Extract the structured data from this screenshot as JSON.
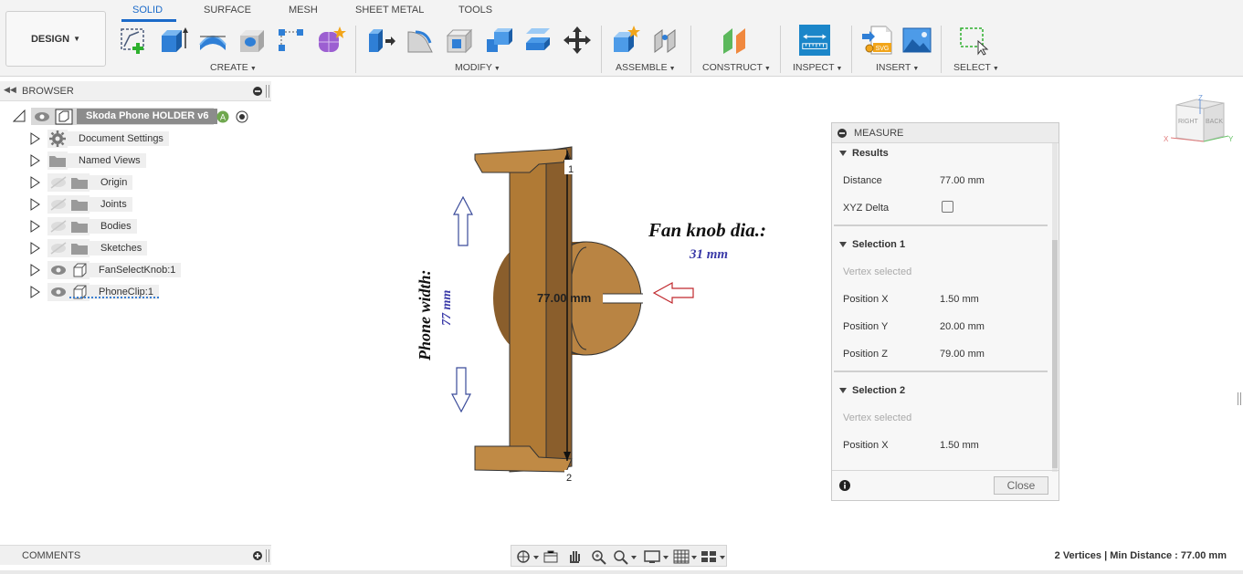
{
  "toolbar": {
    "workspace": "DESIGN",
    "tabs": [
      {
        "label": "SOLID",
        "active": true
      },
      {
        "label": "SURFACE",
        "active": false
      },
      {
        "label": "MESH",
        "active": false
      },
      {
        "label": "SHEET METAL",
        "active": false
      },
      {
        "label": "TOOLS",
        "active": false
      }
    ],
    "groups": {
      "create": "CREATE",
      "modify": "MODIFY",
      "assemble": "ASSEMBLE",
      "construct": "CONSTRUCT",
      "inspect": "INSPECT",
      "insert": "INSERT",
      "select": "SELECT"
    },
    "insert_svg_badge": "SVG",
    "accent_color": "#1b6ac9"
  },
  "browser": {
    "title": "BROWSER",
    "root": "Skoda Phone HOLDER v6",
    "items": [
      {
        "label": "Document Settings",
        "icon": "gear-icon"
      },
      {
        "label": "Named Views",
        "icon": "folder-icon"
      },
      {
        "label": "Origin",
        "icon": "folder-icon",
        "hidden": true
      },
      {
        "label": "Joints",
        "icon": "folder-icon",
        "hidden": true
      },
      {
        "label": "Bodies",
        "icon": "folder-icon",
        "hidden": true
      },
      {
        "label": "Sketches",
        "icon": "folder-icon",
        "hidden": true
      },
      {
        "label": "FanSelectKnob:1",
        "icon": "component-icon"
      },
      {
        "label": "PhoneClip:1",
        "icon": "component-icon"
      }
    ]
  },
  "viewport": {
    "dimension_label": "77.00 mm",
    "point_1": "1",
    "point_2": "2",
    "annotation_fan": "Fan knob dia.:",
    "annotation_fan_value": "31 mm",
    "annotation_phone": "Phone width:",
    "annotation_phone_value": "77 mm",
    "viewcube_right": "RIGHT",
    "viewcube_back": "BACK",
    "axis_x": "X",
    "axis_y": "Y",
    "axis_z": "Z",
    "model_color": "#b07a35"
  },
  "measure": {
    "title": "MEASURE",
    "results_label": "Results",
    "distance_label": "Distance",
    "distance_value": "77.00 mm",
    "xyz_delta_label": "XYZ Delta",
    "selection1": {
      "title": "Selection 1",
      "status": "Vertex selected",
      "x_label": "Position X",
      "x_value": "1.50 mm",
      "y_label": "Position Y",
      "y_value": "20.00 mm",
      "z_label": "Position Z",
      "z_value": "79.00 mm"
    },
    "selection2": {
      "title": "Selection 2",
      "status": "Vertex selected",
      "x_label": "Position X",
      "x_value": "1.50 mm"
    },
    "close_label": "Close"
  },
  "comments": {
    "title": "COMMENTS"
  },
  "status_bar": {
    "text": "2 Vertices | Min Distance : 77.00 mm"
  }
}
